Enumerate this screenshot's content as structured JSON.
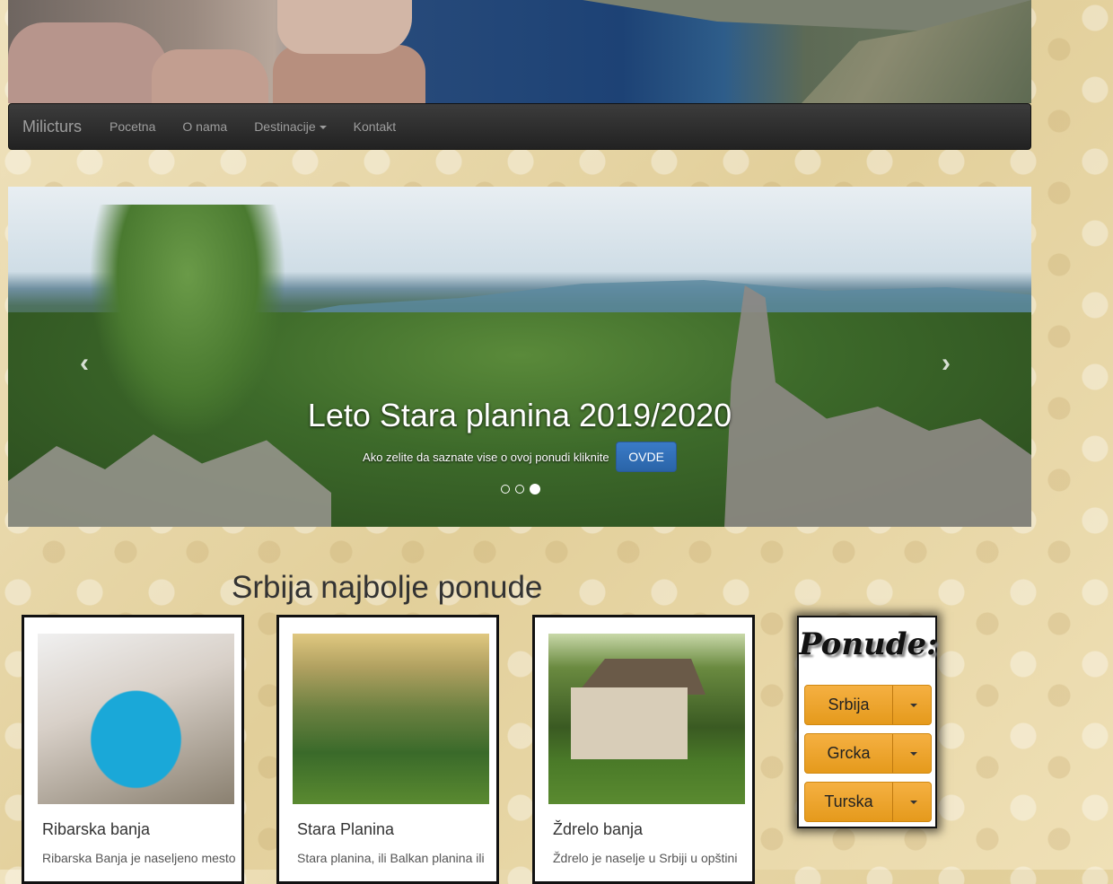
{
  "navbar": {
    "brand": "Milicturs",
    "items": [
      {
        "label": "Pocetna"
      },
      {
        "label": "O nama"
      },
      {
        "label": "Destinacije"
      },
      {
        "label": "Kontakt"
      }
    ]
  },
  "carousel": {
    "title": "Leto Stara planina 2019/2020",
    "subtitle": "Ako zelite da saznate vise o ovoj ponudi kliknite",
    "button": "OVDE",
    "slide_count": 3,
    "active_slide": 3,
    "prev_glyph": "‹",
    "next_glyph": "›"
  },
  "section": {
    "title": "Srbija najbolje ponude"
  },
  "cards": [
    {
      "title": "Ribarska banja",
      "text": "Ribarska Banja je naseljeno mesto",
      "image": "pool-photo"
    },
    {
      "title": "Stara Planina",
      "text": "Stara planina, ili Balkan planina ili",
      "image": "mountain-photo"
    },
    {
      "title": "Ždrelo banja",
      "text": "Ždrelo je naselje u Srbiji u opštini",
      "image": "house-photo"
    }
  ],
  "side_panel": {
    "title": "Ponude:",
    "buttons": [
      {
        "label": "Srbija"
      },
      {
        "label": "Grcka"
      },
      {
        "label": "Turska"
      }
    ]
  },
  "colors": {
    "navbar_bg": "#222222",
    "primary_button": "#2a64a8",
    "warning_button": "#f0a030"
  }
}
